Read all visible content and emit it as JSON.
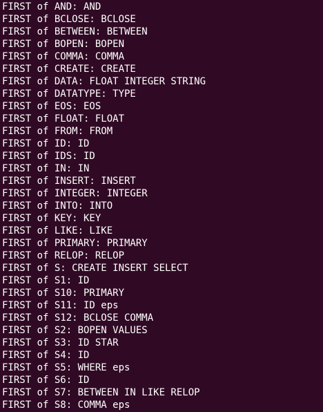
{
  "terminal": {
    "lines": [
      "FIRST of AND: AND",
      "FIRST of BCLOSE: BCLOSE",
      "FIRST of BETWEEN: BETWEEN",
      "FIRST of BOPEN: BOPEN",
      "FIRST of COMMA: COMMA",
      "FIRST of CREATE: CREATE",
      "FIRST of DATA: FLOAT INTEGER STRING",
      "FIRST of DATATYPE: TYPE",
      "FIRST of EOS: EOS",
      "FIRST of FLOAT: FLOAT",
      "FIRST of FROM: FROM",
      "FIRST of ID: ID",
      "FIRST of IDS: ID",
      "FIRST of IN: IN",
      "FIRST of INSERT: INSERT",
      "FIRST of INTEGER: INTEGER",
      "FIRST of INTO: INTO",
      "FIRST of KEY: KEY",
      "FIRST of LIKE: LIKE",
      "FIRST of PRIMARY: PRIMARY",
      "FIRST of RELOP: RELOP",
      "FIRST of S: CREATE INSERT SELECT",
      "FIRST of S1: ID",
      "FIRST of S10: PRIMARY",
      "FIRST of S11: ID eps",
      "FIRST of S12: BCLOSE COMMA",
      "FIRST of S2: BOPEN VALUES",
      "FIRST of S3: ID STAR",
      "FIRST of S4: ID",
      "FIRST of S5: WHERE eps",
      "FIRST of S6: ID",
      "FIRST of S7: BETWEEN IN LIKE RELOP",
      "FIRST of S8: COMMA eps"
    ]
  },
  "colors": {
    "background": "#300a24",
    "text": "#ffffff"
  }
}
